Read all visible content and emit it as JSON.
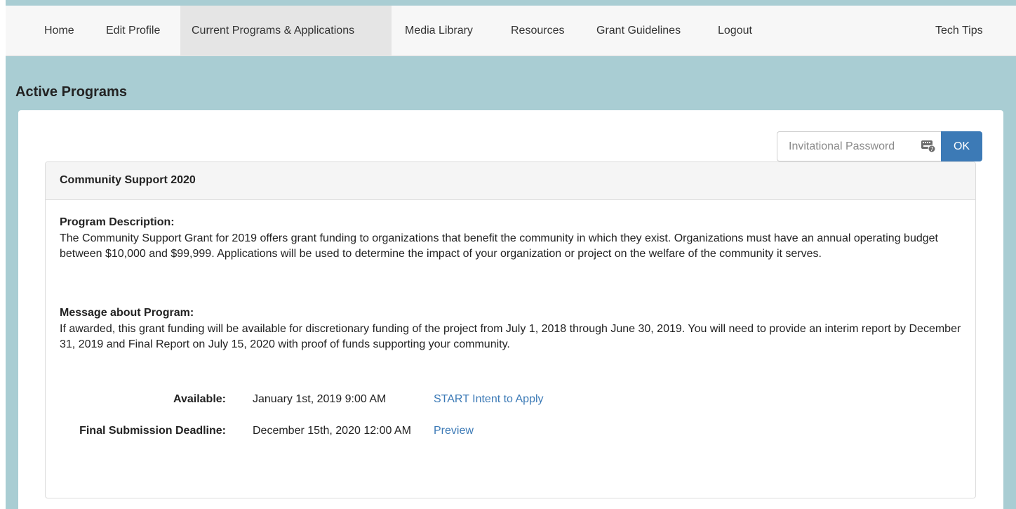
{
  "nav": {
    "items": [
      {
        "label": "Home"
      },
      {
        "label": "Edit Profile"
      },
      {
        "label": "Current Programs & Applications"
      },
      {
        "label": "Media Library"
      },
      {
        "label": "Resources"
      },
      {
        "label": "Grant Guidelines"
      },
      {
        "label": "Logout"
      }
    ],
    "tech_tips": "Tech Tips",
    "active_index": 2
  },
  "page": {
    "heading": "Active Programs"
  },
  "invitational": {
    "placeholder": "Invitational Password",
    "ok_label": "OK",
    "icon": "password-keyboard-icon"
  },
  "program": {
    "title": "Community Support 2020",
    "description_label": "Program Description:",
    "description": "The Community Support Grant for 2019 offers grant funding to organizations that benefit the community in which they exist. Organizations must have an annual operating budget between $10,000 and $99,999. Applications will be used to determine the impact of your organization or project on the welfare of the community it serves.",
    "message_label": "Message about Program:",
    "message": "If awarded, this grant funding will be available for discretionary funding of the project from July 1, 2018 through June 30, 2019. You will need to provide an interim report by December 31, 2019 and Final Report on July 15, 2020 with proof of funds supporting your community.",
    "available_label": "Available:",
    "available_value": "January 1st, 2019 9:00 AM",
    "start_link": "START Intent to Apply",
    "deadline_label": "Final Submission Deadline:",
    "deadline_value": "December 15th, 2020 12:00 AM",
    "preview_link": "Preview"
  },
  "colors": {
    "background": "#a9cdd3",
    "accent": "#3c7ab6",
    "nav_bg": "#f7f7f7",
    "nav_active_bg": "#e5e5e5"
  }
}
